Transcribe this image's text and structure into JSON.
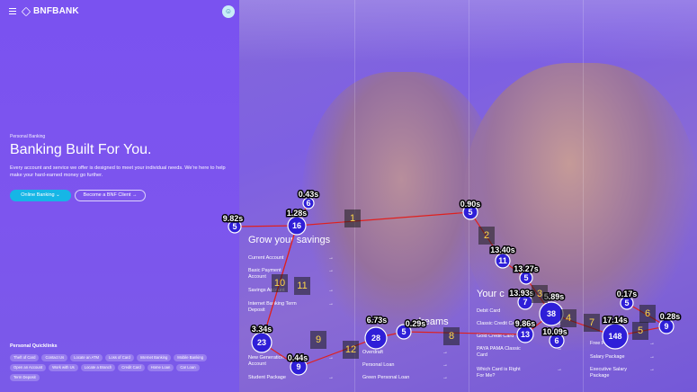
{
  "brand": {
    "name": "BNFBANK",
    "avatar_icon": "chat-icon"
  },
  "hero": {
    "kicker": "Personal Banking",
    "title": "Banking Built For You.",
    "description": "Every account and service we offer is designed to meet your individual needs. We're here to help make your hard-earned money go further.",
    "primary_button": "Online Banking ⌄",
    "secondary_button": "Become a BNF Client →"
  },
  "quicklinks": {
    "title": "Personal Quicklinks",
    "row1": [
      "Theft of Card",
      "Contact Us",
      "Locate an ATM",
      "Loss of Card",
      "Internet Banking",
      "Mobile Banking"
    ],
    "row2": [
      "Open an Account",
      "Work with Us",
      "Locate a Branch",
      "Credit Card",
      "Home Loan",
      "Car Loan"
    ],
    "row3": [
      "Term Deposit"
    ]
  },
  "sections": {
    "savings": {
      "title": "Grow your savings",
      "items": [
        "Current Account",
        "Basic Payment Account",
        "Savings Account",
        "Internet Banking Term Deposit",
        "",
        "",
        "New Generation Account",
        "Student Package"
      ]
    },
    "dreams": {
      "title": "dreams",
      "items": [
        "Overdraft",
        "Personal Loan",
        "Green Personal Loan"
      ]
    },
    "cards": {
      "title": "Your c",
      "items": [
        "Debit Card",
        "Classic Credit Card",
        "Gold Credit Card",
        "PAYA PAMA Classic Card",
        "Which Card is Right For Me?"
      ]
    },
    "packages": {
      "items": [
        "Free Package",
        "Salary Package",
        "Executive Salary Package"
      ]
    }
  },
  "markers": [
    {
      "n": "5",
      "t": "9.82s"
    },
    {
      "n": "16",
      "t": "1.28s"
    },
    {
      "n": "6",
      "t": "0.43s"
    },
    {
      "n": "5",
      "t": "0.90s"
    },
    {
      "n": "11",
      "t": "13.40s"
    },
    {
      "n": "5",
      "t": "13.27s"
    },
    {
      "n": "7",
      "t": "13.93s"
    },
    {
      "n": "38",
      "t": "5.89s"
    },
    {
      "n": "13",
      "t": "9.86s"
    },
    {
      "n": "6",
      "t": "10.09s"
    },
    {
      "n": "148",
      "t": "17.14s"
    },
    {
      "n": "5",
      "t": "0.17s"
    },
    {
      "n": "9",
      "t": "0.28s"
    },
    {
      "n": "23",
      "t": "3.34s"
    },
    {
      "n": "9",
      "t": "0.44s"
    },
    {
      "n": "28",
      "t": "6.73s"
    },
    {
      "n": "5",
      "t": "0.29s"
    }
  ],
  "steps": [
    "1",
    "2",
    "3",
    "4",
    "5",
    "6",
    "7",
    "8",
    "9",
    "10",
    "11",
    "12"
  ]
}
